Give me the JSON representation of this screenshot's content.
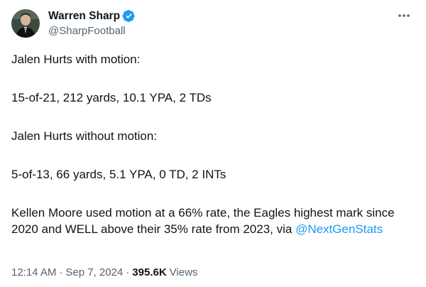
{
  "author": {
    "display_name": "Warren Sharp",
    "handle": "@SharpFootball",
    "verified": true,
    "verified_icon": "verified-badge-icon",
    "accent_color": "#1d9bf0"
  },
  "tweet": {
    "paragraphs": [
      "Jalen Hurts with motion:",
      "15-of-21, 212 yards, 10.1 YPA, 2 TDs",
      "Jalen Hurts without motion:",
      "5-of-13, 66 yards, 5.1 YPA, 0 TD, 2 INTs"
    ],
    "last_paragraph_text": "Kellen Moore used motion at a 66% rate, the Eagles highest mark since 2020 and WELL above their 35% rate from 2023, via ",
    "mention": "@NextGenStats"
  },
  "meta": {
    "time": "12:14 AM",
    "separator": "·",
    "date": "Sep 7, 2024",
    "views_count": "395.6K",
    "views_label": "Views"
  },
  "actions": {
    "more_icon": "more-dots-icon"
  }
}
